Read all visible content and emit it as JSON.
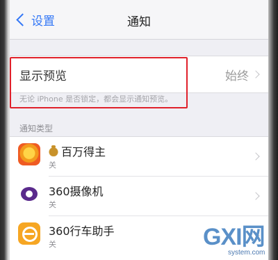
{
  "navbar": {
    "back_label": "设置",
    "title": "通知"
  },
  "preview": {
    "label": "显示预览",
    "value": "始终",
    "footer": "无论 iPhone 是否锁定，都会显示通知预览。"
  },
  "section_header": "通知类型",
  "apps": [
    {
      "name": "百万得主",
      "status": "关",
      "icon": "millionaire-app-icon"
    },
    {
      "name": "360摄像机",
      "status": "关",
      "icon": "camera-360-app-icon"
    },
    {
      "name": "360行车助手",
      "status": "关",
      "icon": "drive-assistant-360-app-icon"
    }
  ],
  "watermark": {
    "main": "GXI网",
    "sub": "system.com"
  },
  "colors": {
    "accent": "#3478f6",
    "highlight": "#e0202a"
  }
}
